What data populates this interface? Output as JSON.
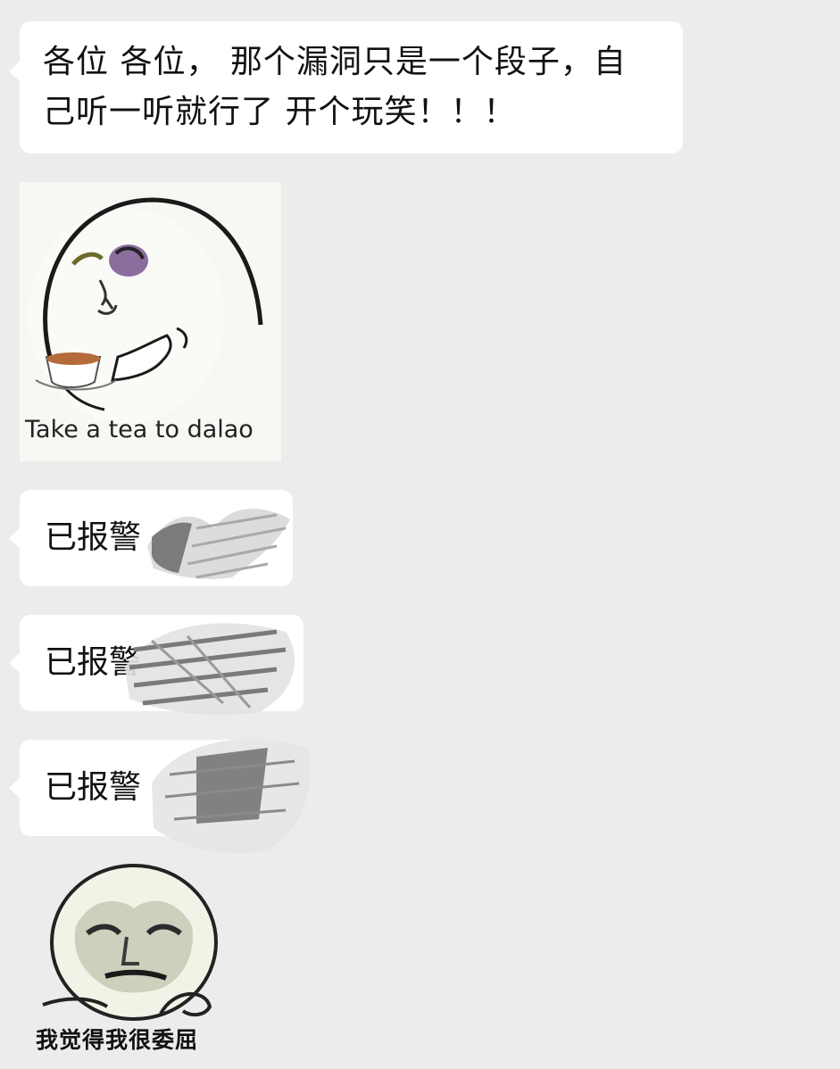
{
  "messages": [
    {
      "type": "text",
      "text_line1": "各位 各位， 那个漏洞只是一个段子，自",
      "text_line2": "己听一听就行了  开个玩笑！！！"
    },
    {
      "type": "sticker",
      "caption": "Take a tea to dalao"
    },
    {
      "type": "text",
      "text": "已报警"
    },
    {
      "type": "text",
      "text": "已报警"
    },
    {
      "type": "text",
      "text": "已报警"
    },
    {
      "type": "sticker",
      "caption": "我觉得我很委屈"
    }
  ],
  "colors": {
    "background": "#ececec",
    "bubble": "#ffffff",
    "text": "#111111"
  }
}
